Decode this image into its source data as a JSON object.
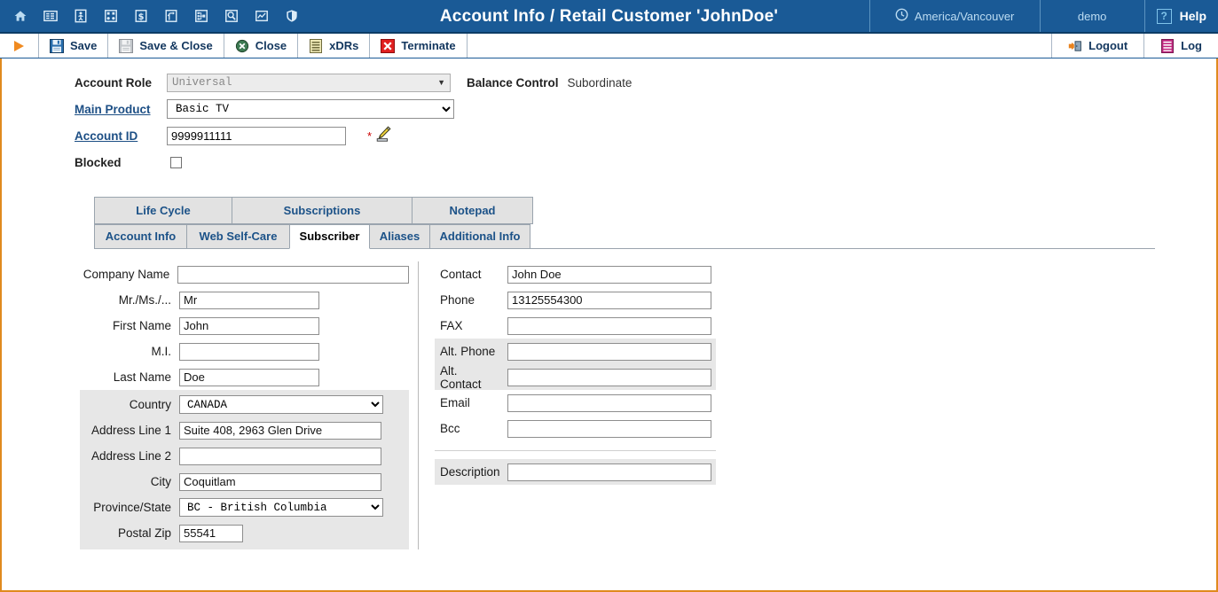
{
  "header": {
    "title": "Account Info / Retail Customer 'JohnDoe'",
    "timezone": "America/Vancouver",
    "user": "demo",
    "help_label": "Help",
    "nav_icons": [
      "home-icon",
      "accounts-list-icon",
      "customer-icon",
      "products-icon",
      "dollar-icon",
      "routing-icon",
      "sitemap-icon",
      "search-icon",
      "statistics-icon",
      "security-icon"
    ],
    "clock_icon": "clock-icon",
    "help_icon": "question-mark-icon"
  },
  "toolbar": {
    "play_icon": "play-triangle-icon",
    "save_label": "Save",
    "save_close_label": "Save & Close",
    "close_label": "Close",
    "xdrs_label": "xDRs",
    "terminate_label": "Terminate",
    "logout_label": "Logout",
    "log_label": "Log"
  },
  "account": {
    "role_label": "Account Role",
    "role_value": "Universal",
    "balance_control_label": "Balance Control",
    "balance_control_value": "Subordinate",
    "main_product_label": "Main Product",
    "main_product_value": "Basic TV",
    "account_id_label": "Account ID",
    "account_id_value": "9999911111",
    "required_marker": "*",
    "pencil_icon": "pencil-edit-icon",
    "blocked_label": "Blocked",
    "blocked_checked": false
  },
  "tabs": {
    "top_row": [
      {
        "label": "Life Cycle",
        "active": false
      },
      {
        "label": "Subscriptions",
        "active": false
      },
      {
        "label": "Notepad",
        "active": false
      }
    ],
    "bottom_row": [
      {
        "label": "Account Info",
        "active": false
      },
      {
        "label": "Web Self-Care",
        "active": false
      },
      {
        "label": "Subscriber",
        "active": true
      },
      {
        "label": "Aliases",
        "active": false
      },
      {
        "label": "Additional Info",
        "active": false
      }
    ]
  },
  "left_column": {
    "company_name_label": "Company Name",
    "company_name_value": "",
    "salutation_label": "Mr./Ms./...",
    "salutation_value": "Mr",
    "first_name_label": "First Name",
    "first_name_value": "John",
    "mi_label": "M.I.",
    "mi_value": "",
    "last_name_label": "Last Name",
    "last_name_value": "Doe",
    "country_label": "Country",
    "country_value": "CANADA",
    "address1_label": "Address Line 1",
    "address1_value": "Suite 408, 2963 Glen Drive",
    "address2_label": "Address Line 2",
    "address2_value": "",
    "city_label": "City",
    "city_value": "Coquitlam",
    "province_label": "Province/State",
    "province_value": "BC - British Columbia",
    "postal_label": "Postal Zip",
    "postal_value": "55541"
  },
  "right_column": {
    "contact_label": "Contact",
    "contact_value": "John Doe",
    "phone_label": "Phone",
    "phone_value": "13125554300",
    "fax_label": "FAX",
    "fax_value": "",
    "alt_phone_label": "Alt. Phone",
    "alt_phone_value": "",
    "alt_contact_label": "Alt. Contact",
    "alt_contact_value": "",
    "email_label": "Email",
    "email_value": "",
    "bcc_label": "Bcc",
    "bcc_value": "",
    "description_label": "Description",
    "description_value": ""
  },
  "colors": {
    "header_blue": "#1a5a96",
    "accent_orange": "#e08a1e",
    "link_blue": "#1c5288",
    "shade_gray": "#e7e7e7"
  }
}
